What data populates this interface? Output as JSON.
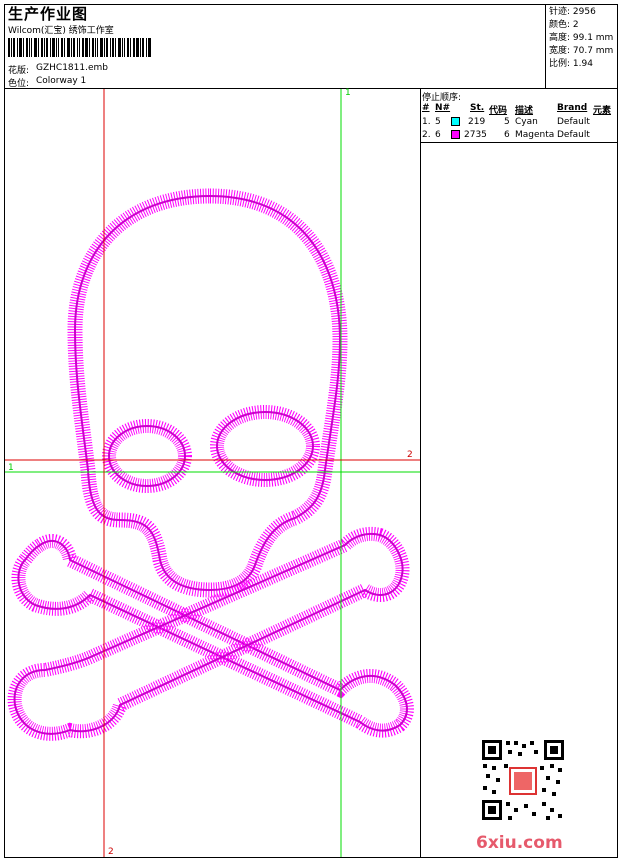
{
  "header": {
    "title": "生产作业图",
    "subtitle": "Wilcom(汇宝) 绣饰工作室",
    "design_label": "花版:",
    "design_value": "GZHC1811.emb",
    "colorway_label": "色位:",
    "colorway_value": "Colorway 1"
  },
  "stats": {
    "stitches": "针迹: 2956",
    "colors": "颜色: 2",
    "height": "高度: 99.1 mm",
    "width": "宽度: 70.7 mm",
    "scale": "比例: 1.94"
  },
  "stop_sequence": {
    "title": "停止顺序:",
    "headers": [
      "#",
      "N#",
      "St.",
      "代码",
      "描述",
      "Brand",
      "元素"
    ],
    "rows": [
      {
        "idx": "1.",
        "n": "5",
        "color": "#00FFFF",
        "st": "219",
        "code": "5",
        "desc": "Cyan",
        "brand": "Default",
        "elem": ""
      },
      {
        "idx": "2.",
        "n": "6",
        "color": "#FF00FF",
        "st": "2735",
        "code": "6",
        "desc": "Magenta",
        "brand": "Default",
        "elem": ""
      }
    ]
  },
  "guides": {
    "green_top": "1",
    "green_left": "1",
    "red_right": "2",
    "red_bottom": "2"
  },
  "design_color": "#FF00FF",
  "watermark": "6xiu.com"
}
